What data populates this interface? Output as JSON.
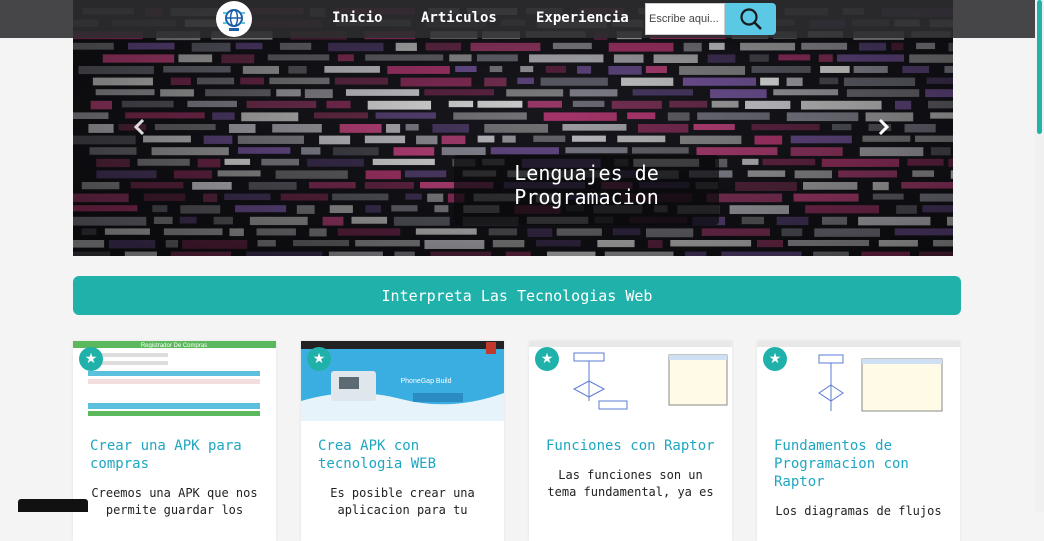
{
  "nav": {
    "logo_icon": "globe-circuit-logo",
    "links": [
      "Inicio",
      "Articulos",
      "Experiencia"
    ],
    "search_placeholder": "Escribe aqui...",
    "search_icon": "magnifier-icon"
  },
  "carousel": {
    "caption_line1": "Lenguajes de",
    "caption_line2": "Programacion",
    "prev_icon": "chevron-left-icon",
    "next_icon": "chevron-right-icon"
  },
  "banner": {
    "title": "Interpreta Las Tecnologias Web"
  },
  "cards": [
    {
      "title": "Crear una APK para compras",
      "text": "Creemos una APK que nos permite guardar los",
      "image_header": "Registrador De Compras"
    },
    {
      "title": "Crea APK con tecnologia WEB",
      "text": "Es posible crear una aplicacion para tu",
      "image_header": "PhoneGap Build"
    },
    {
      "title": "Funciones con Raptor",
      "text": "Las funciones son un tema fundamental, ya es",
      "image_header": ""
    },
    {
      "title": "Fundamentos de Programacion con Raptor",
      "text": "Los diagramas de flujos",
      "image_header": ""
    }
  ],
  "colors": {
    "accent": "#20b2aa",
    "link": "#1fa6c2",
    "navbar": "#2d2d30",
    "search_button": "#5bc8e6"
  }
}
